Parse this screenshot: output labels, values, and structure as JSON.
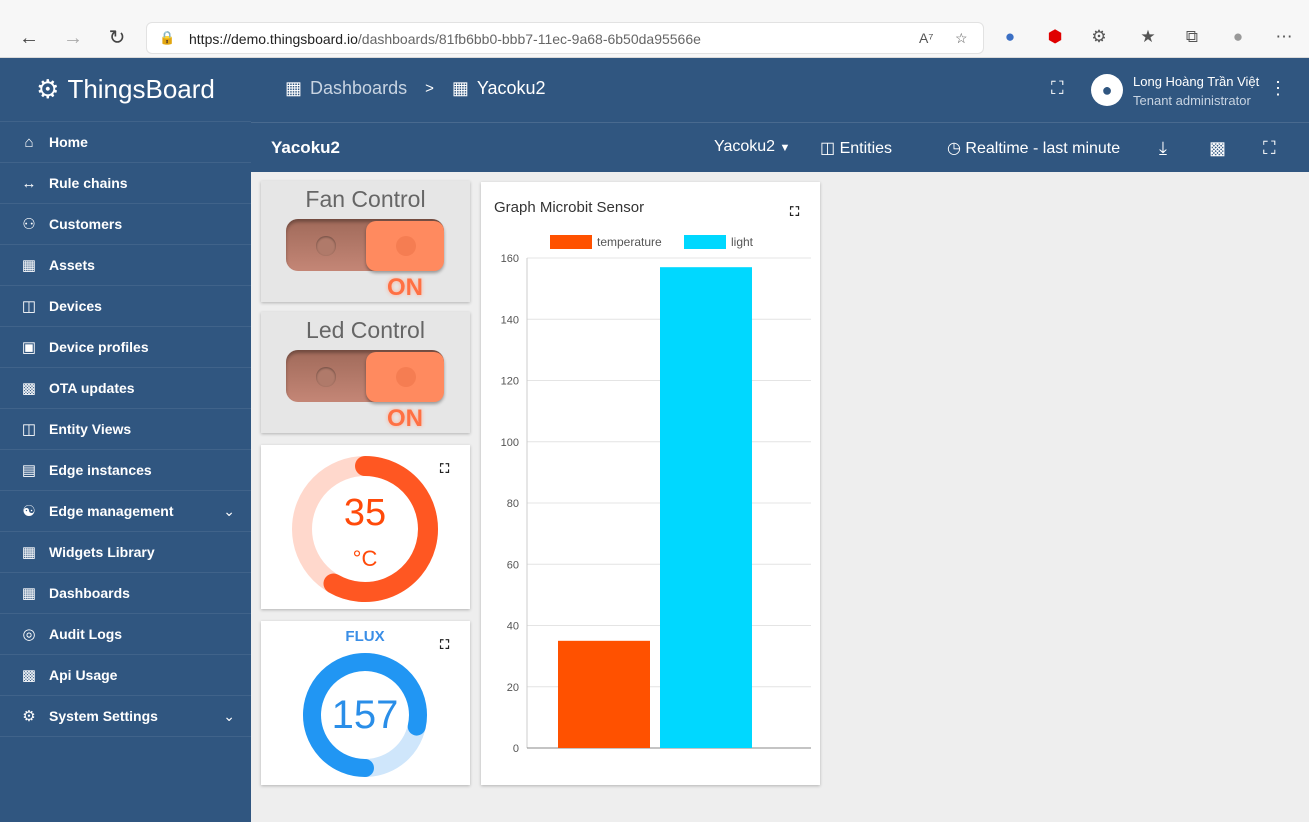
{
  "browser": {
    "url_host": "https://demo.thingsboard.io",
    "url_path": "/dashboards/81fb6bb0-bbb7-11ec-9a68-6b50da95566e"
  },
  "sidebar": {
    "logo_text": "ThingsBoard",
    "items": [
      {
        "label": "Home",
        "icon": "home-icon"
      },
      {
        "label": "Rule chains",
        "icon": "rule-chains-icon"
      },
      {
        "label": "Customers",
        "icon": "customers-icon"
      },
      {
        "label": "Assets",
        "icon": "assets-icon"
      },
      {
        "label": "Devices",
        "icon": "devices-icon"
      },
      {
        "label": "Device profiles",
        "icon": "device-profiles-icon"
      },
      {
        "label": "OTA updates",
        "icon": "ota-icon"
      },
      {
        "label": "Entity Views",
        "icon": "entity-views-icon"
      },
      {
        "label": "Edge instances",
        "icon": "edge-icon"
      },
      {
        "label": "Edge management",
        "icon": "edge-management-icon"
      },
      {
        "label": "Widgets Library",
        "icon": "widgets-icon"
      },
      {
        "label": "Dashboards",
        "icon": "dashboards-icon"
      },
      {
        "label": "Audit Logs",
        "icon": "audit-icon"
      },
      {
        "label": "Api Usage",
        "icon": "api-usage-icon"
      },
      {
        "label": "System Settings",
        "icon": "settings-icon"
      }
    ]
  },
  "header": {
    "breadcrumb_root": "Dashboards",
    "breadcrumb_sep": ">",
    "breadcrumb_current": "Yacoku2",
    "user_name": "Long Hoàng Trần Việt",
    "user_role": "Tenant administrator"
  },
  "toolbar": {
    "title": "Yacoku2",
    "state_select": "Yacoku2",
    "entities_label": "Entities",
    "timewindow_label": "Realtime - last minute"
  },
  "widgets": {
    "fan": {
      "title": "Fan Control",
      "state": "ON"
    },
    "led": {
      "title": "Led Control",
      "state": "ON"
    },
    "temperature": {
      "value": "35",
      "unit": "°C",
      "value_num": 35,
      "max": 60,
      "color": "#ff5722"
    },
    "flux": {
      "label": "FLUX",
      "value": "157",
      "value_num": 157,
      "max": 200,
      "color": "#2196f3"
    }
  },
  "chart_data": {
    "type": "bar",
    "title": "Graph Microbit Sensor",
    "series": [
      {
        "name": "temperature",
        "values": [
          35
        ],
        "color": "#ff5100"
      },
      {
        "name": "light",
        "values": [
          157
        ],
        "color": "#00d8ff"
      }
    ],
    "ylim": [
      0,
      160
    ],
    "yticks": [
      0,
      20,
      40,
      60,
      80,
      100,
      120,
      140,
      160
    ],
    "legend": "top"
  }
}
